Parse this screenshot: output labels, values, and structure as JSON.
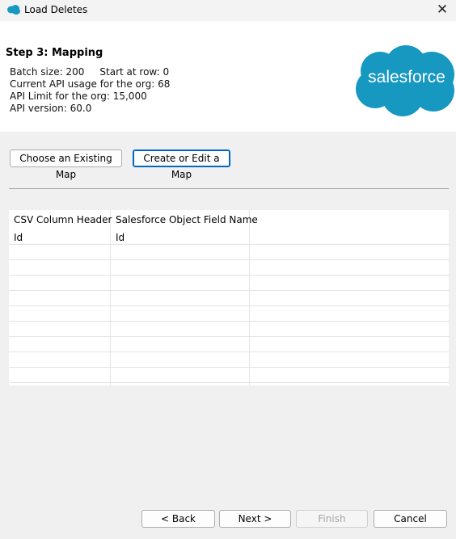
{
  "window": {
    "title": "Load Deletes",
    "close_glyph": "✕"
  },
  "header": {
    "step_title": "Step 3: Mapping",
    "batch_info": "Batch size: 200     Start at row: 0",
    "api_usage": "Current API usage for the org: 68",
    "api_limit": "API Limit for the org: 15,000",
    "api_version": "API version: 60.0",
    "logo_text": "salesforce",
    "logo_color": "#1798c1"
  },
  "mapping_buttons": {
    "choose_existing": "Choose an Existing Map",
    "create_or_edit": "Create or Edit a Map"
  },
  "table": {
    "columns": [
      "CSV Column Header",
      "Salesforce Object Field Name"
    ],
    "rows": [
      [
        "Id",
        "Id"
      ]
    ]
  },
  "footer": {
    "back": "< Back",
    "next": "Next >",
    "finish": "Finish",
    "cancel": "Cancel"
  }
}
